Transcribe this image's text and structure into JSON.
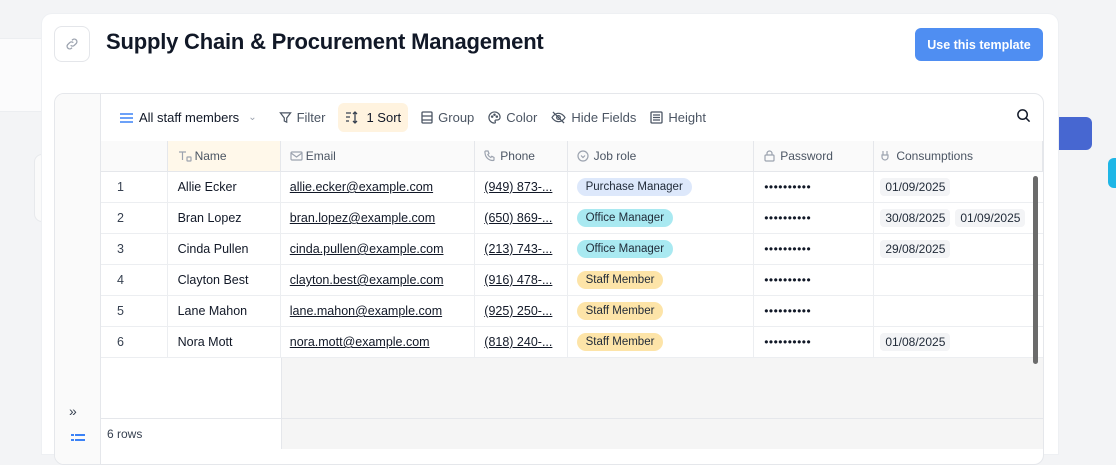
{
  "header": {
    "title": "Supply Chain & Procurement Management",
    "use_template_label": "Use this template"
  },
  "toolbar": {
    "view_label": "All staff members",
    "filter_label": "Filter",
    "sort_label": "1 Sort",
    "group_label": "Group",
    "color_label": "Color",
    "hide_fields_label": "Hide Fields",
    "height_label": "Height"
  },
  "columns": [
    "Name",
    "Email",
    "Phone",
    "Job role",
    "Password",
    "Consumptions"
  ],
  "rows": [
    {
      "num": "1",
      "name": "Allie Ecker",
      "email": "allie.ecker@example.com",
      "phone": "(949) 873-...",
      "role": "Purchase Manager",
      "password": "••••••••••",
      "consumptions": [
        "01/09/2025"
      ]
    },
    {
      "num": "2",
      "name": "Bran Lopez",
      "email": "bran.lopez@example.com",
      "phone": "(650) 869-...",
      "role": "Office Manager",
      "password": "••••••••••",
      "consumptions": [
        "30/08/2025",
        "01/09/2025"
      ]
    },
    {
      "num": "3",
      "name": "Cinda Pullen",
      "email": "cinda.pullen@example.com",
      "phone": "(213) 743-...",
      "role": "Office Manager",
      "password": "••••••••••",
      "consumptions": [
        "29/08/2025"
      ]
    },
    {
      "num": "4",
      "name": "Clayton Best",
      "email": "clayton.best@example.com",
      "phone": "(916) 478-...",
      "role": "Staff Member",
      "password": "••••••••••",
      "consumptions": []
    },
    {
      "num": "5",
      "name": "Lane Mahon",
      "email": "lane.mahon@example.com",
      "phone": "(925) 250-...",
      "role": "Staff Member",
      "password": "••••••••••",
      "consumptions": []
    },
    {
      "num": "6",
      "name": "Nora Mott",
      "email": "nora.mott@example.com",
      "phone": "(818) 240-...",
      "role": "Staff Member",
      "password": "••••••••••",
      "consumptions": [
        "01/08/2025"
      ]
    }
  ],
  "role_colors": {
    "Purchase Manager": "#dde8fb",
    "Office Manager": "#a9e9f1",
    "Staff Member": "#fde4a8"
  },
  "footer": {
    "row_count": "6 rows"
  },
  "icons": {
    "link": "link-icon",
    "view": "list-view-icon",
    "filter": "filter-icon",
    "sort": "sort-icon",
    "group": "group-icon",
    "color": "palette-icon",
    "hide_fields": "eye-off-icon",
    "height": "row-height-icon",
    "search": "search-icon",
    "expand": "expand-sidebar-icon"
  },
  "colors": {
    "accent": "#4f8ef2",
    "sort_active_bg": "#fff3df"
  }
}
